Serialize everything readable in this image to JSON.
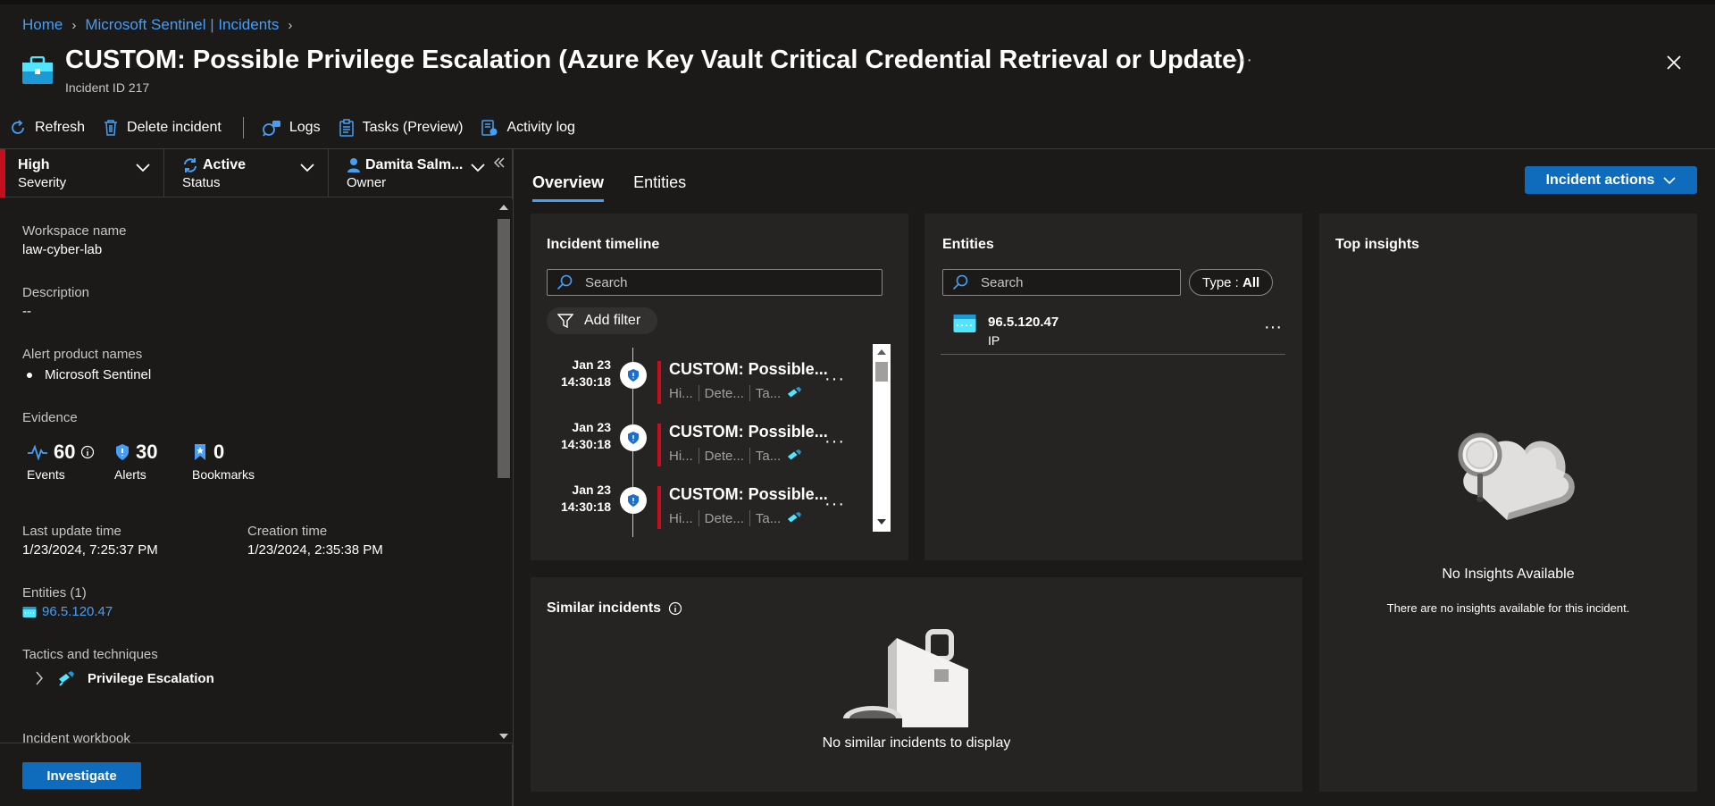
{
  "breadcrumb": {
    "home": "Home",
    "parent": "Microsoft Sentinel | Incidents"
  },
  "header": {
    "title": "CUSTOM: Possible Privilege Escalation (Azure Key Vault Critical Credential Retrieval or Update)",
    "incident_id": "Incident ID 217",
    "more": "···"
  },
  "toolbar": {
    "refresh": "Refresh",
    "delete": "Delete incident",
    "logs": "Logs",
    "tasks": "Tasks (Preview)",
    "activity_log": "Activity log"
  },
  "status": {
    "severity_value": "High",
    "severity_label": "Severity",
    "status_value": "Active",
    "status_label": "Status",
    "owner_value": "Damita Salm...",
    "owner_label": "Owner"
  },
  "details": {
    "workspace_label": "Workspace name",
    "workspace_value": "law-cyber-lab",
    "description_label": "Description",
    "description_value": "--",
    "alert_products_label": "Alert product names",
    "alert_product": "Microsoft Sentinel",
    "evidence_label": "Evidence",
    "events_count": "60",
    "events_label": "Events",
    "alerts_count": "30",
    "alerts_label": "Alerts",
    "bookmarks_count": "0",
    "bookmarks_label": "Bookmarks",
    "last_update_label": "Last update time",
    "last_update_value": "1/23/2024, 7:25:37 PM",
    "creation_label": "Creation time",
    "creation_value": "1/23/2024, 2:35:38 PM",
    "entities_label": "Entities (1)",
    "entity_ip": "96.5.120.47",
    "tactics_label": "Tactics and techniques",
    "tactic": "Privilege Escalation",
    "workbook_label": "Incident workbook"
  },
  "investigate_label": "Investigate",
  "tabs": [
    "Overview",
    "Entities"
  ],
  "incident_actions_label": "Incident actions",
  "timeline": {
    "title": "Incident timeline",
    "search_placeholder": "Search",
    "add_filter": "Add filter",
    "items": [
      {
        "date": "Jan 23",
        "time": "14:30:18",
        "name": "CUSTOM: Possible...",
        "sev": "Hi...",
        "source": "Dete...",
        "tactic": "Ta..."
      },
      {
        "date": "Jan 23",
        "time": "14:30:18",
        "name": "CUSTOM: Possible...",
        "sev": "Hi...",
        "source": "Dete...",
        "tactic": "Ta..."
      },
      {
        "date": "Jan 23",
        "time": "14:30:18",
        "name": "CUSTOM: Possible...",
        "sev": "Hi...",
        "source": "Dete...",
        "tactic": "Ta..."
      }
    ]
  },
  "entities_card": {
    "title": "Entities",
    "search_placeholder": "Search",
    "type_prefix": "Type : ",
    "type_value": "All",
    "entity_name": "96.5.120.47",
    "entity_type": "IP"
  },
  "insights": {
    "title": "Top insights",
    "empty_title": "No Insights Available",
    "empty_body": "There are no insights available for this incident."
  },
  "similar": {
    "title": "Similar incidents",
    "empty": "No similar incidents to display"
  },
  "colors": {
    "accent": "#0f6cbd",
    "link": "#479ef5",
    "severity_high": "#c50f1f",
    "icon_blue": "#50e6ff"
  }
}
